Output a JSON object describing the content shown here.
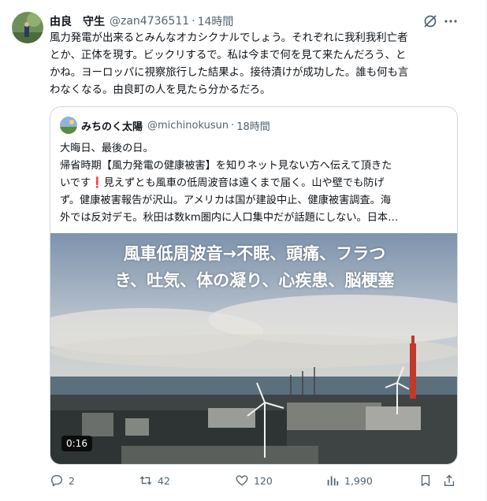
{
  "tweet": {
    "author_name": "由良　守生",
    "author_handle": "@zan4736511",
    "separator": "·",
    "time": "14時間",
    "lines": [
      "風力発電が出来るとみんなオカシクナルでしょう。それぞれに我利我利亡者",
      "とか、正体を現す。ビックリするで。私は今まで何を見て来たんだろう、と",
      "かね。ヨーロッパに視察旅行した結果よ。接待漬けが成功した。誰も何も言",
      "わなくなる。由良町の人を見たら分かるだろ。"
    ]
  },
  "quote": {
    "author_name": "みちのく太陽",
    "author_handle": "@michinokusun",
    "separator": "·",
    "time": "18時間",
    "line1": "大晦日、最後の日。",
    "line2": "帰省時期【風力発電の健康被害】を知りネット見ない方へ伝えて頂きた",
    "line3_a": "いです",
    "line3_emoji": "❗",
    "line3_b": "見えずとも風車の低周波音は遠くまで届く。山や壁でも防げ",
    "line4": "ず。健康被害報告が沢山。アメリカは国が建設中止、健康被害調査。海",
    "line5": "外では反対デモ。秋田は数km圏内に人口集中だが話題にしない。日本…",
    "media": {
      "caption_line1": "風車低周波音→不眠、頭痛、フラつ",
      "caption_line2": "き、吐気、体の凝り、心疾患、脳梗塞",
      "duration": "0:16"
    }
  },
  "actions": {
    "replies": "2",
    "reposts": "42",
    "likes": "120",
    "views": "1,990"
  },
  "icons": [
    "grok-icon",
    "more-icon",
    "reply-icon",
    "repost-icon",
    "like-icon",
    "views-icon",
    "bookmark-icon",
    "share-icon"
  ]
}
